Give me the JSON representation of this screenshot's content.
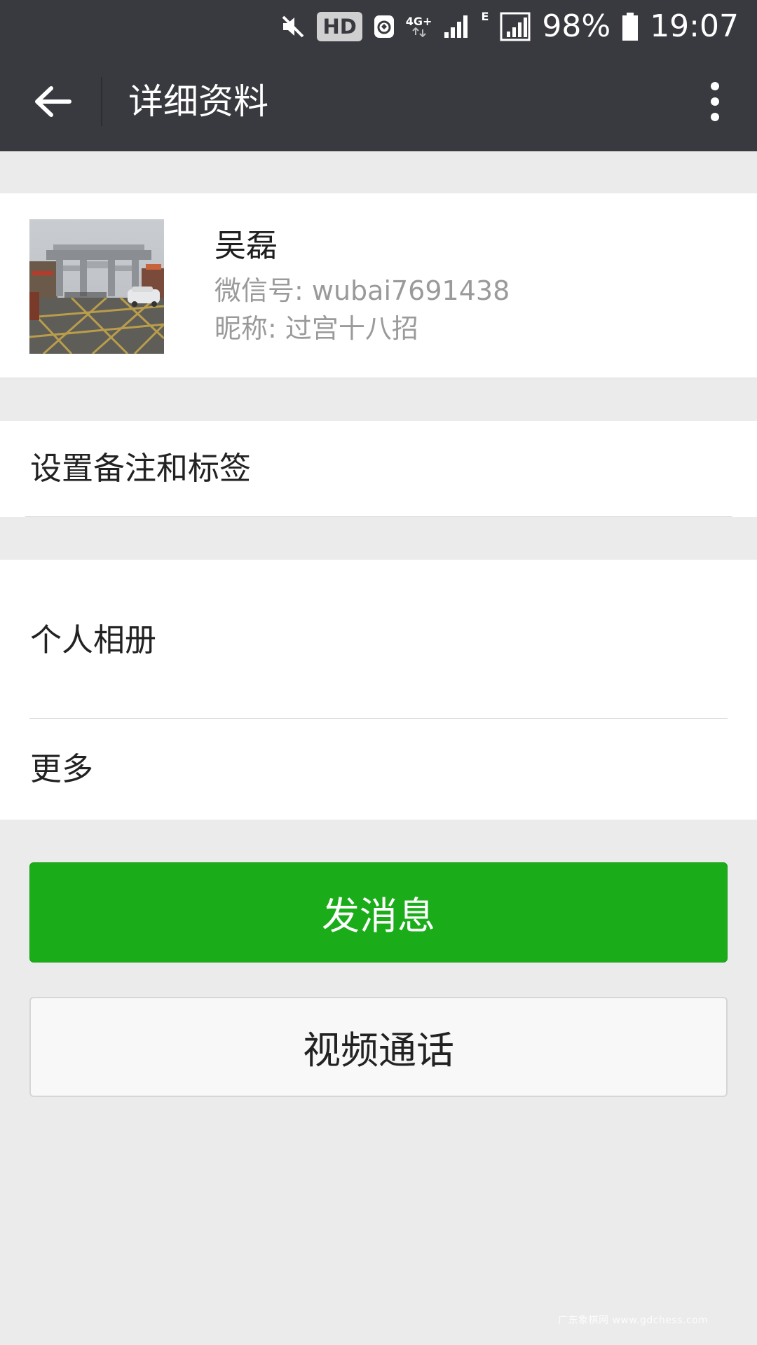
{
  "status_bar": {
    "icons": [
      "mute-icon",
      "hd-icon",
      "vpn-icon",
      "4g-signal-icon",
      "e-signal-icon",
      "battery-icon"
    ],
    "hd_label": "HD",
    "network_4g_label": "4G+",
    "network_e_label": "E",
    "battery_percent": "98%",
    "time": "19:07"
  },
  "app_bar": {
    "title": "详细资料",
    "back_icon": "arrow-left-icon",
    "more_icon": "more-vertical-icon"
  },
  "profile": {
    "name": "吴磊",
    "wechat_id_line": "微信号: wubai7691438",
    "nickname_line": "昵称: 过宫十八招"
  },
  "list": {
    "remarks_tags": "设置备注和标签",
    "albums": "个人相册",
    "more": "更多"
  },
  "actions": {
    "send_message": "发消息",
    "video_call": "视频通话"
  },
  "watermark": "广东象棋网 www.gdchess.com",
  "colors": {
    "status_bar": "#393a3f",
    "background": "#ebebeb",
    "primary_button": "#1aad19",
    "secondary_button": "#f8f8f8"
  }
}
